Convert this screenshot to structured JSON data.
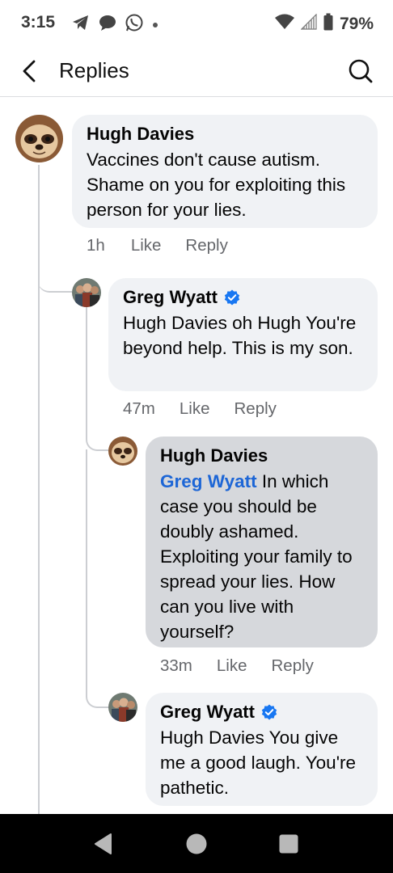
{
  "status_bar": {
    "time": "3:15",
    "battery": "79%"
  },
  "header": {
    "title": "Replies"
  },
  "comments": [
    {
      "author": "Hugh Davies",
      "verified": false,
      "mention": "",
      "text": "Vaccines don't cause autism. Shame on you for exploiting this person for your lies.",
      "time": "1h",
      "like_label": "Like",
      "reply_label": "Reply"
    },
    {
      "author": "Greg Wyatt",
      "verified": true,
      "mention": "",
      "text": "Hugh Davies oh Hugh You're beyond help. This is my son.",
      "time": "47m",
      "like_label": "Like",
      "reply_label": "Reply"
    },
    {
      "author": "Hugh Davies",
      "verified": false,
      "mention": "Greg Wyatt",
      "text": "In which case you should be doubly ashamed. Exploiting your family to spread your lies. How can you live with yourself?",
      "time": "33m",
      "like_label": "Like",
      "reply_label": "Reply"
    },
    {
      "author": "Greg Wyatt",
      "verified": true,
      "mention": "",
      "text": "Hugh Davies You give me a good laugh. You're pathetic.",
      "time": "",
      "like_label": "",
      "reply_label": ""
    }
  ],
  "colors": {
    "bubble": "#f0f2f5",
    "bubble_highlight": "#d6d8dc",
    "mention": "#1d66d6",
    "verified": "#1877f2",
    "meta_text": "#65676b"
  }
}
